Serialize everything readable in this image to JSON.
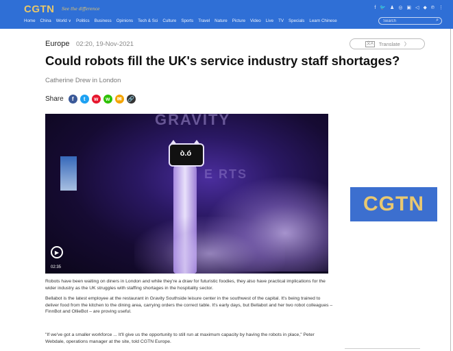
{
  "header": {
    "logo": "CGTN",
    "tagline": "See the difference",
    "nav": [
      "Home",
      "China",
      "World ∨",
      "Politics",
      "Business",
      "Opinions",
      "Tech & Sci",
      "Culture",
      "Sports",
      "Travel",
      "Nature",
      "Picture",
      "Video",
      "Live",
      "TV",
      "Specials",
      "Learn Chinese"
    ],
    "search_placeholder": "Search",
    "social_icons": [
      "f",
      "🐦",
      "♟",
      "◎",
      "▣",
      "◁",
      "◆",
      "℗",
      "⋮"
    ]
  },
  "article": {
    "section": "Europe",
    "datetime": "02:20, 19-Nov-2021",
    "translate_label": "Translate",
    "title": "Could robots fill the UK's service industry staff shortages?",
    "byline": "Catherine Drew in London",
    "share_label": "Share",
    "share_icons": [
      {
        "name": "facebook-icon",
        "glyph": "f",
        "color": "#3b5998"
      },
      {
        "name": "twitter-icon",
        "glyph": "t",
        "color": "#1da1f2"
      },
      {
        "name": "weibo-icon",
        "glyph": "w",
        "color": "#e6162d"
      },
      {
        "name": "wechat-icon",
        "glyph": "w",
        "color": "#2dc100"
      },
      {
        "name": "message-icon",
        "glyph": "✉",
        "color": "#f4a400"
      },
      {
        "name": "link-icon",
        "glyph": "🔗",
        "color": "#333333"
      }
    ],
    "video": {
      "duration": "02:35",
      "wall_text_1": "GRAVITY",
      "wall_text_2": "E  RTS",
      "robot_eyes": "ò.ó"
    },
    "paragraphs": [
      "Robots have been waiting on diners in London and while they're a draw for futuristic foodies, they also have practical implications for the wider industry as the UK struggles with staffing shortages in the hospitality sector.",
      "Bellabot is the latest employee at the restaurant in Gravity Southside leisure center in the southwest of the capital. It's being trained to deliver food from the kitchen to the dining area, carrying orders the correct table. It's early days, but Bellabot and her two robot colleagues – FinnBot and OllieBot – are proving useful.",
      "\"If we've got a smaller workforce ... It'll give us the opportunity to still run at maximum capacity by having the robots in place,\" Peter Webdale, operations manager at the site, told CGTN Europe."
    ]
  },
  "sidebar": {
    "brand": "CGTN"
  },
  "colors": {
    "header_bg": "#2f6fd6",
    "logo_gold": "#e8c76a",
    "brand_box_bg": "#3c6fcf"
  }
}
